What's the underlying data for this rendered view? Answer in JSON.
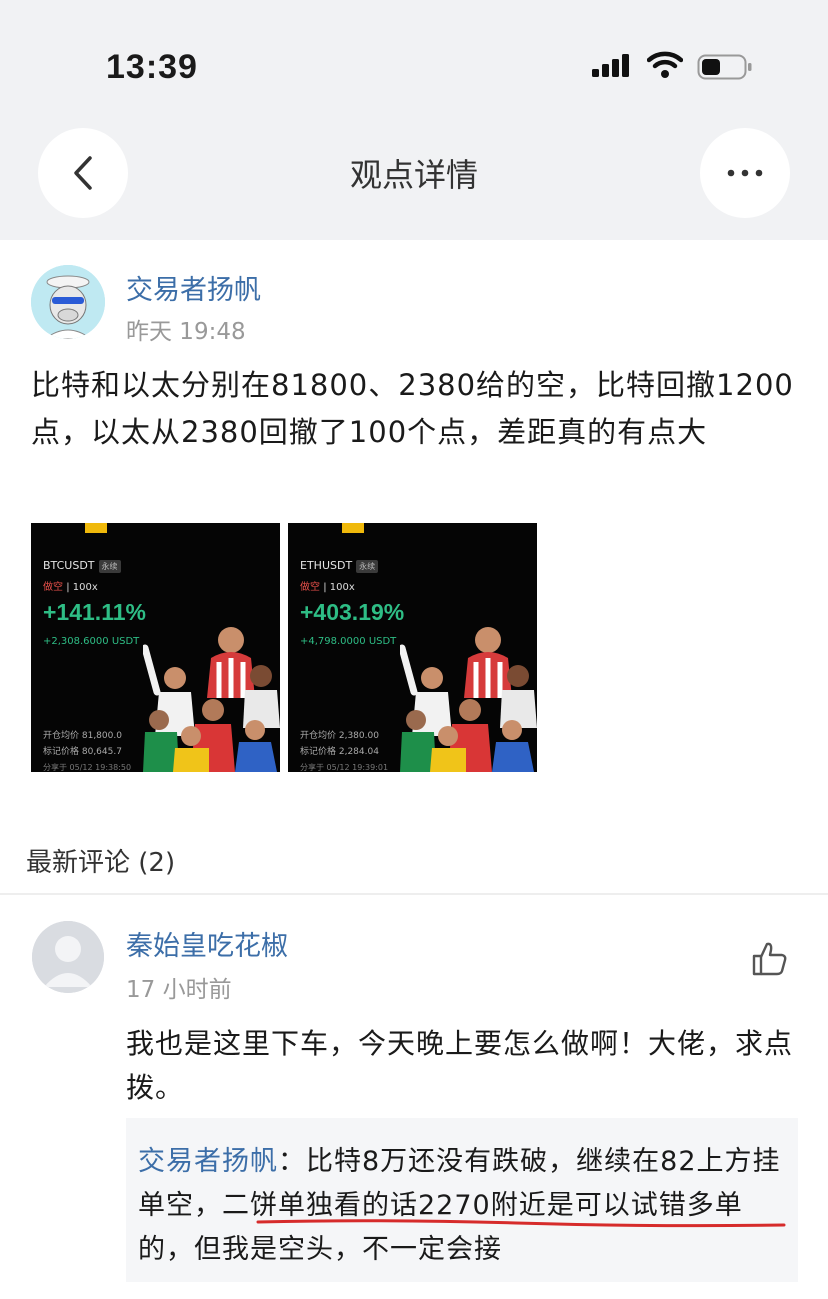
{
  "status_bar": {
    "time": "13:39"
  },
  "nav": {
    "title": "观点详情"
  },
  "post": {
    "author": "交易者扬帆",
    "time": "昨天 19:48",
    "text": "比特和以太分别在81800、2380给的空，比特回撤1200点，以太从2380回撤了100个点，差距真的有点大",
    "cards": [
      {
        "pair": "BTCUSDT",
        "perp_tag": "永续",
        "side": "做空",
        "leverage": "| 100x",
        "pct": "+141.11%",
        "pnl": "+2,308.6000 USDT",
        "entry": "开仓均价  81,800.0",
        "mark": "标记价格  80,645.7",
        "shared": "分享于 05/12 19:38:50"
      },
      {
        "pair": "ETHUSDT",
        "perp_tag": "永续",
        "side": "做空",
        "leverage": "| 100x",
        "pct": "+403.19%",
        "pnl": "+4,798.0000 USDT",
        "entry": "开仓均价  2,380.00",
        "mark": "标记价格  2,284.04",
        "shared": "分享于 05/12 19:39:01"
      }
    ]
  },
  "comments": {
    "header": "最新评论 (2)",
    "items": [
      {
        "author": "秦始皇吃花椒",
        "time": "17 小时前",
        "text": "我也是这里下车，今天晚上要怎么做啊！大佬，求点拨。",
        "reply": {
          "author": "交易者扬帆",
          "text": "：比特8万还没有跌破，继续在82上方挂单空，二饼单独看的话2270附近是可以试错多单的，但我是空头，不一定会接"
        }
      }
    ]
  },
  "colors": {
    "link": "#3c6ea8",
    "profit": "#2ebd85",
    "short": "#e8504a",
    "underline": "#d62b2b"
  }
}
